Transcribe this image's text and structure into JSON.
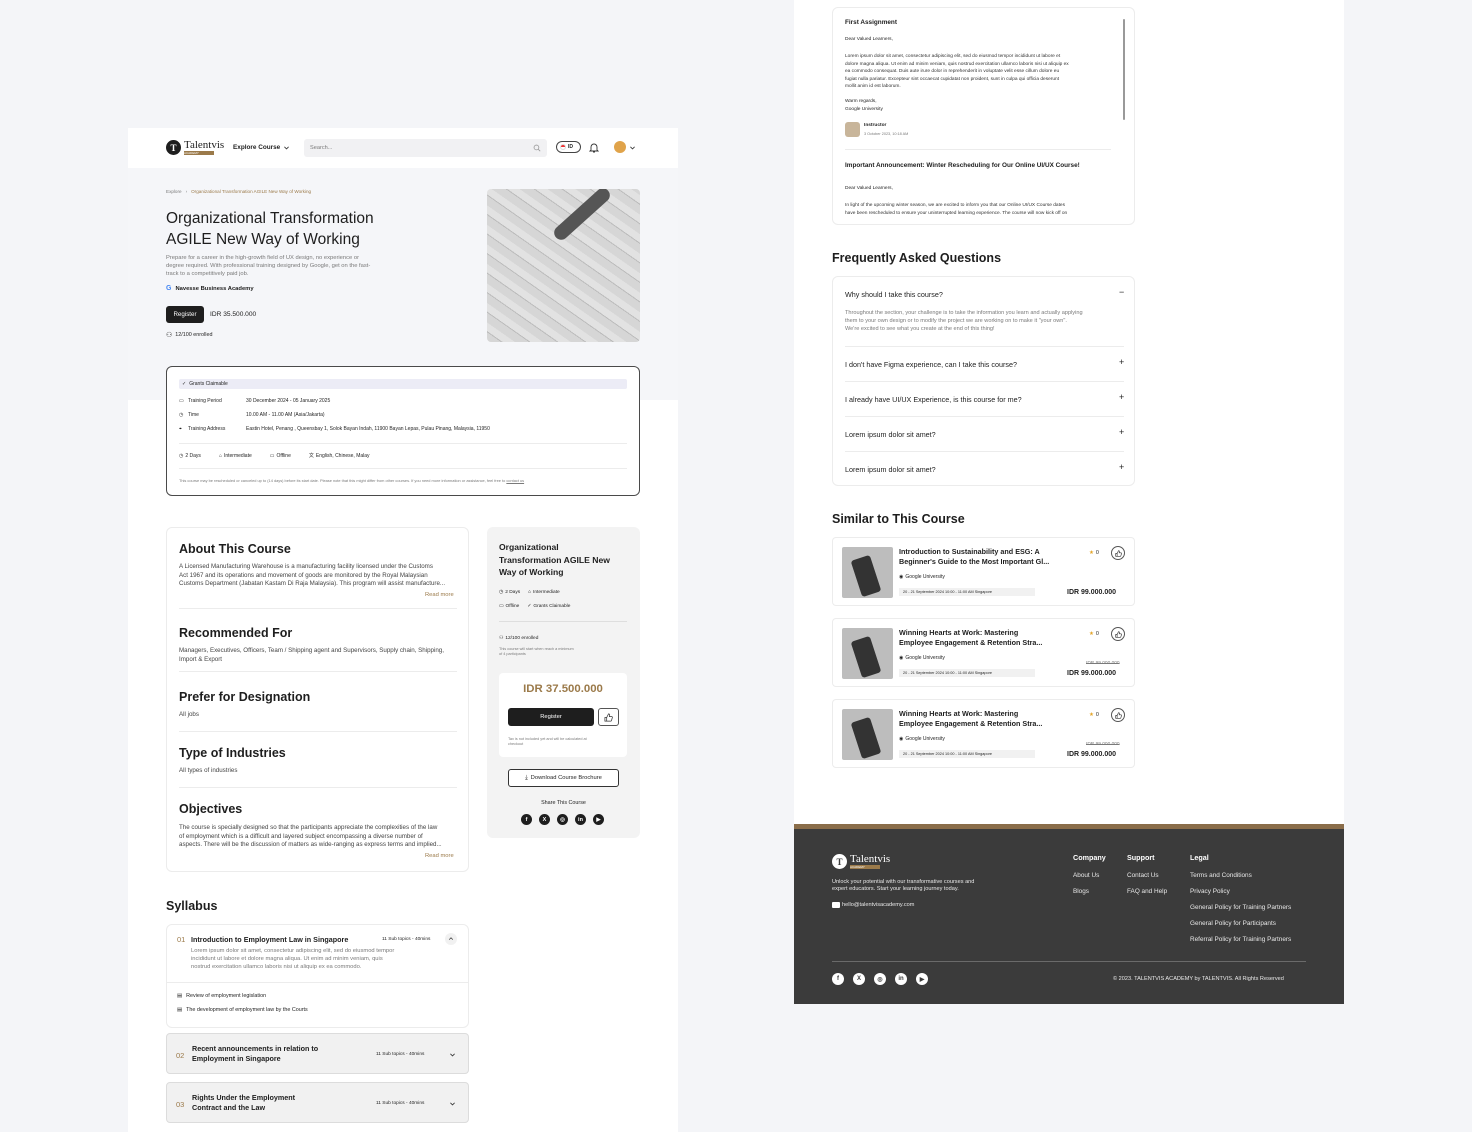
{
  "brand": {
    "logo_letter": "T",
    "name": "Talentvis",
    "tag": "ACADEMY",
    "accent": "#9b7a4a",
    "dark": "#1e1e1e"
  },
  "nav": {
    "explore_label": "Explore Course",
    "search_placeholder": "Search...",
    "lang": "ID"
  },
  "breadcrumb": {
    "root": "Explore",
    "current": "Organizational Transformation AGILE New Way of Working"
  },
  "course": {
    "title_line1": "Organizational Transformation",
    "title_line2": "AGILE New Way of Working",
    "description_line1": "Prepare for a career in the high-growth field of UX design, no experience or",
    "description_line2": "degree required. With professional training designed by Google, get on the fast-",
    "description_line3": "track to a competitively paid job.",
    "provider": "Navesse Business Academy",
    "register_label": "Register",
    "price": "IDR 35.500.000",
    "enrolled": "12/100 enrolled"
  },
  "details": {
    "badge": "Grants Claimable",
    "rows": [
      {
        "label": "Training Period",
        "value": "30 December 2024 - 05 January 2025"
      },
      {
        "label": "Time",
        "value": "10.00 AM - 11.00 AM (Asia/Jakarta)"
      },
      {
        "label": "Training Address",
        "value": "Eastin Hotel, Penang , Queensbay 1, Solok Bayan Indah, 11900 Bayan Lepas, Pulau Pinang, Malaysia, 11950"
      }
    ],
    "meta": {
      "duration": "2 Days",
      "level": "Intermediate",
      "mode": "Offline",
      "languages": "English, Chinese, Malay"
    },
    "note": "This course may be rescheduled or canceled up to (14 days) before its start date. Please note that this might differ from other courses. If you need more information or assistance, feel free to",
    "note_link": "contact us"
  },
  "about": {
    "title": "About This Course",
    "line1": "A Licensed Manufacturing Warehouse is a manufacturing facility licensed under the Customs",
    "line2": "Act 1967 and its operations and movement of goods are monitored by the Royal Malaysian",
    "line3": "Customs Department (Jabatan Kastam Di Raja Malaysia). This program will assist manufacture...",
    "read_more": "Read more"
  },
  "recommended": {
    "title": "Recommended For",
    "line1": "Managers, Executives, Officers, Team / Shipping agent and Supervisors, Supply chain, Shipping,",
    "line2": "Import & Export"
  },
  "designation": {
    "title": "Prefer for Designation",
    "text": "All jobs"
  },
  "industries": {
    "title": "Type of Industries",
    "text": "All types of industries"
  },
  "objectives": {
    "title": "Objectives",
    "line1": "The course is specially designed so that the participants appreciate the complexities of the law",
    "line2": "of employment which is a difficult and layered subject encompassing a diverse number of",
    "line3": "aspects. There will be the discussion of matters as wide-ranging as express terms and implied...",
    "read_more": "Read more"
  },
  "side": {
    "title_line1": "Organizational",
    "title_line2": "Transformation AGILE New",
    "title_line3": "Way of Working",
    "duration": "2 Days",
    "level": "Intermediate",
    "mode": "Offline",
    "grants": "Grants Claimable",
    "enrolled": "12/100 enrolled",
    "min_note_line1": "This course will start when reach a minimum",
    "min_note_line2": "of 4 participants",
    "price": "IDR 37.500.000",
    "register_label": "Register",
    "tax_line1": "Tax is not included yet and will be calculated at",
    "tax_line2": "checkout",
    "brochure_label": "Download Course Brochure",
    "share_label": "Share This Course"
  },
  "syllabus": {
    "title": "Syllabus",
    "items": [
      {
        "num": "01",
        "title": "Introduction to Employment Law in Singapore",
        "meta": "11 Sub topics - 40mins",
        "desc1": "Lorem ipsum dolor sit amet, consectetur adipiscing elit, sed do eiusmod tempor",
        "desc2": "incididunt ut labore et dolore magna aliqua. Ut enim ad minim veniam, quis",
        "desc3": "nostrud exercitation ullamco laboris nisi ut aliquip ex ea commodo.",
        "sub1": "Review of employment legislation",
        "sub2": "The development of employment law by the Courts"
      },
      {
        "num": "02",
        "title1": "Recent announcements in relation to",
        "title2": "Employment in Singapore",
        "meta": "11 Sub topics - 40mins"
      },
      {
        "num": "03",
        "title1": "Rights Under the Employment",
        "title2": "Contract and the Law",
        "meta": "11 Sub topics - 40mins"
      }
    ]
  },
  "announcements": {
    "first_title": "First Assignment",
    "greeting": "Dear Valued Learners,",
    "body1": "Lorem ipsum dolor sit amet, consectetur adipiscing elit, sed do eiusmod tempor incididunt ut labore et",
    "body2": "dolore magna aliqua. Ut enim ad minim veniam, quis nostrud exercitation ullamco laboris nisi ut aliquip ex",
    "body3": "ea commodo consequat. Duis aute irure dolor in reprehenderit in voluptate velit esse cillum dolore eu",
    "body4": "fugiat nulla pariatur. Excepteur sint occaecat cupidatat non proident, sunt in culpa qui officia deserunt",
    "body5": "mollit anim id est laborum.",
    "regards": "Warm regards,",
    "signature": "Google University",
    "author": "Instructor",
    "date": "3 October 2023, 10:18 AM",
    "second_title": "Important Announcement: Winter Rescheduling for Our Online UI/UX Course!",
    "second_greeting": "Dear Valued Learners,",
    "second_body1": "In light of the upcoming winter season, we are excited to inform you that our Online UI/UX Course dates",
    "second_body2": "have been rescheduled to ensure your uninterrupted learning experience. The course will now kick off on"
  },
  "faq": {
    "title": "Frequently Asked Questions",
    "items": [
      {
        "q": "Why should I take this course?",
        "a1": "Throughout the section, your challenge is to take the information you learn and actually applying",
        "a2": "them to your own design or to modify the project we are working on to make it \"your own\".",
        "a3": "We're excited to see what you create at the end of this thing!"
      },
      {
        "q": "I don't have Figma experience, can I take this course?"
      },
      {
        "q": "I already have UI/UX Experience, is this course for me?"
      },
      {
        "q": "Lorem ipsum dolor sit amet?"
      },
      {
        "q": "Lorem ipsum dolor sit amet?"
      }
    ]
  },
  "similar": {
    "title": "Similar to This Course",
    "items": [
      {
        "title1": "Introduction to Sustainability and ESG: A",
        "title2": "Beginner's Guide to the Most Important Gl...",
        "rating": "0",
        "provider": "Google University",
        "schedule": "20 - 21 September 2024 10:00 - 11:00 AM Singapore",
        "old_price": "",
        "price": "IDR 99.000.000"
      },
      {
        "title1": "Winning Hearts at Work: Mastering",
        "title2": "Employee Engagement & Retention Stra...",
        "rating": "0",
        "provider": "Google University",
        "schedule": "20 - 21 September 2024 10:00 - 11:00 AM Singapore",
        "old_price": "IDR 99.000.000",
        "price": "IDR 99.000.000"
      },
      {
        "title1": "Winning Hearts at Work: Mastering",
        "title2": "Employee Engagement & Retention Stra...",
        "rating": "0",
        "provider": "Google University",
        "schedule": "20 - 21 September 2024 10:00 - 11:00 AM Singapore",
        "old_price": "IDR 99.000.000",
        "price": "IDR 99.000.000"
      }
    ]
  },
  "footer": {
    "tagline1": "Unlock your potential with our transformative courses and",
    "tagline2": "expert educators. Start your learning journey today.",
    "email": "hello@talentvisacademy.com",
    "company": {
      "title": "Company",
      "links": [
        "About Us",
        "Blogs"
      ]
    },
    "support": {
      "title": "Support",
      "links": [
        "Contact Us",
        "FAQ and Help"
      ]
    },
    "legal": {
      "title": "Legal",
      "links": [
        "Terms and Conditions",
        "Privacy Policy",
        "General Policy for Training Partners",
        "General Policy for Participants",
        "Referral Policy for Training Partners"
      ]
    },
    "copyright": "© 2023. TALENTVIS ACADEMY by TALENTVIS. All Rights Reserved"
  },
  "icons": {
    "facebook": "f",
    "x": "X",
    "instagram": "◎",
    "linkedin": "in",
    "youtube": "▶"
  }
}
